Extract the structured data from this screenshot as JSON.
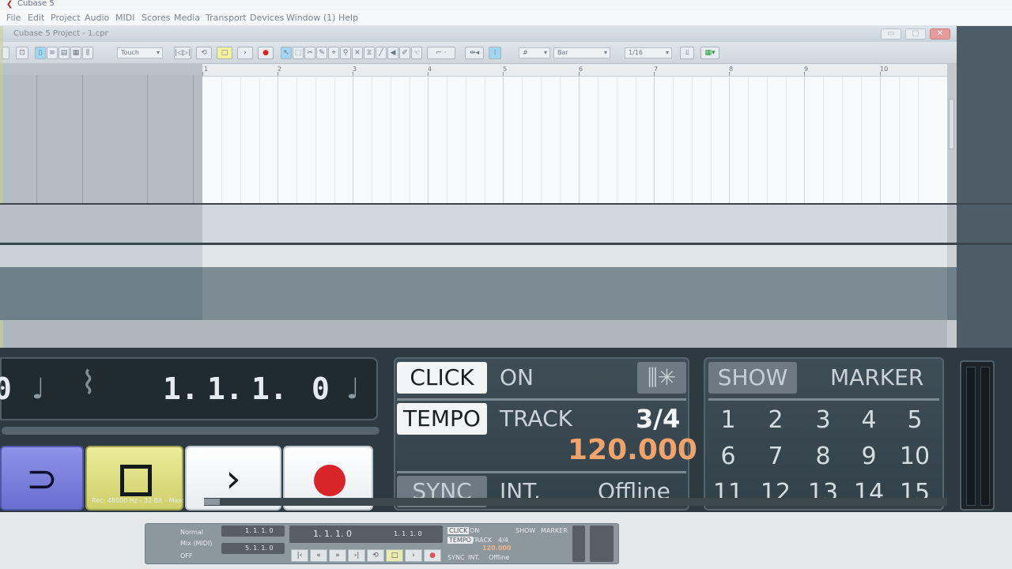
{
  "app": {
    "title": "Cubase 5",
    "icon": "cubase-logo-icon"
  },
  "menu": [
    "File",
    "Edit",
    "Project",
    "Audio",
    "MIDI",
    "Scores",
    "Media",
    "Transport",
    "Devices",
    "Window (1)",
    "Help"
  ],
  "project_window": {
    "title": "Cubase 5 Project - 1.cpr",
    "window_buttons": {
      "minimize": "▭",
      "maximize": "▢",
      "close": "✕"
    }
  },
  "toolbar": {
    "automation_mode": "Touch",
    "grid_type": "Bar",
    "quantize": "1/16"
  },
  "ruler": {
    "bars": [
      "1",
      "2",
      "3",
      "4",
      "5",
      "6",
      "7",
      "8",
      "9",
      "10"
    ]
  },
  "transport": {
    "position": {
      "bars": "1.",
      "beats": "1.",
      "sixteenths": "1.",
      "ticks": "0"
    },
    "left_partial_digit": "0",
    "click_label": "CLICK",
    "click_state": "ON",
    "tempo_label": "TEMPO",
    "tempo_mode": "TRACK",
    "signature": "3/4",
    "tempo_value": "120.000",
    "sync_label": "SYNC",
    "sync_source": "INT.",
    "sync_state": "Offline",
    "show_label": "SHOW",
    "marker_label": "MARKER",
    "markers": [
      "1",
      "2",
      "3",
      "4",
      "5",
      "6",
      "7",
      "8",
      "9",
      "10",
      "11",
      "12",
      "13",
      "14",
      "15"
    ]
  },
  "status": {
    "record_info": "Rec: 48000 Hz - 32 Bit - Max: 349h 46m"
  },
  "mini_transport": {
    "mode": "Normal",
    "mix": "Mix (MIDI)",
    "position_left": "1. 1. 1.   0",
    "position_right": "5. 1. 1.   0",
    "primary_time": "1. 1. 1.  0",
    "secondary_time": "1. 1. 1.  0",
    "click": "CLICK",
    "click_state": "ON",
    "tempo": "TEMPO",
    "tempo_mode": "TRACK",
    "signature": "4/4",
    "tempo_value": "120.000",
    "sync": "SYNC",
    "sync_source": "INT.",
    "sync_state": "Offline",
    "show": "SHOW",
    "marker": "MARKER",
    "off": "OFF"
  }
}
